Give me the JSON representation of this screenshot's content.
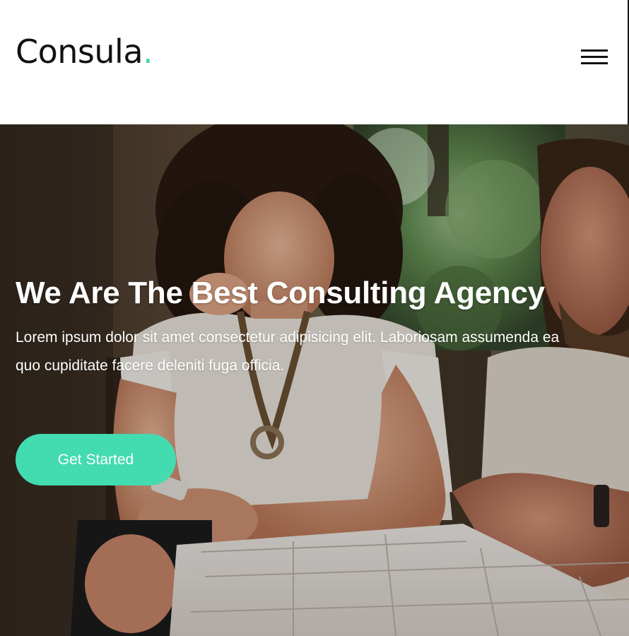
{
  "header": {
    "logo_text": "Consula",
    "logo_dot": ".",
    "menu_icon": "hamburger-menu-icon"
  },
  "hero": {
    "title": "We Are The Best Consulting Agency",
    "description": "Lorem ipsum dolor sit amet consectetur adipisicing elit. Laboriosam assumenda ea quo cupiditate facere deleniti fuga officia.",
    "cta_label": "Get Started"
  },
  "colors": {
    "accent": "#43dbb0",
    "text_dark": "#111111",
    "text_light": "#ffffff"
  }
}
